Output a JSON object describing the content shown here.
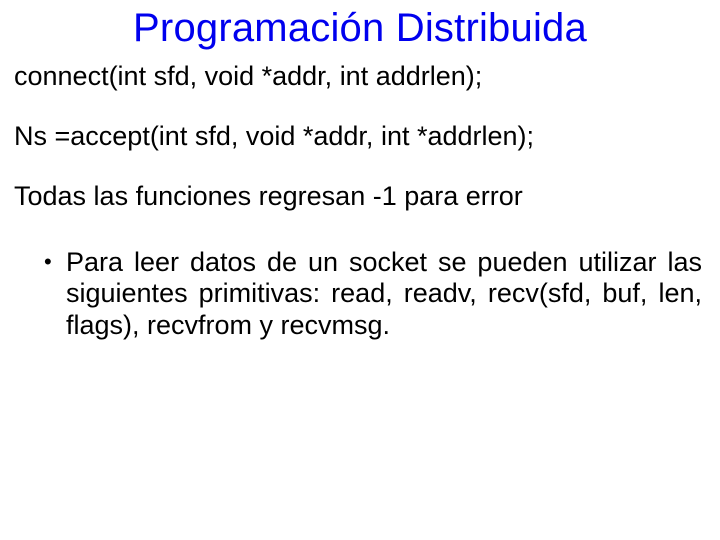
{
  "title": "Programación Distribuida",
  "lines": {
    "connect": "connect(int sfd, void *addr, int addrlen);",
    "accept": "Ns =accept(int sfd, void *addr, int *addrlen);",
    "errnote": "Todas las funciones regresan -1 para error"
  },
  "bullet": {
    "marker": "•",
    "text": "Para leer datos de un socket se pueden utilizar las siguientes primitivas: read, readv, recv(sfd, buf, len, flags), recvfrom y recvmsg."
  }
}
